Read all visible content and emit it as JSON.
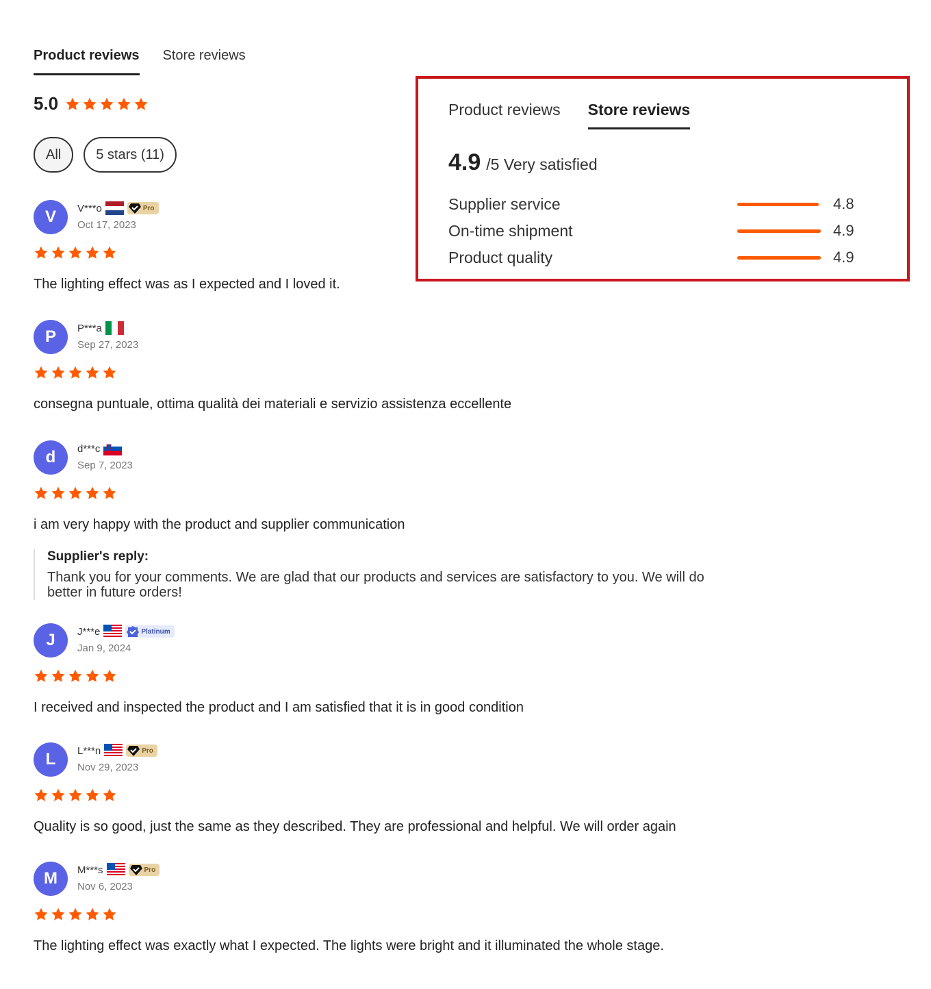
{
  "tabs": {
    "product": "Product reviews",
    "store": "Store reviews"
  },
  "summary": {
    "score": "5.0",
    "stars": 5
  },
  "filters": {
    "all": "All",
    "five": "5 stars (11)"
  },
  "reviews": [
    {
      "initial": "V",
      "name": "V***o",
      "flag": "netherlands",
      "badge": "Pro",
      "date": "Oct 17, 2023",
      "stars": 5,
      "text": "The lighting effect was as I expected and I loved it."
    },
    {
      "initial": "P",
      "name": "P***a",
      "flag": "italy",
      "badge": "",
      "date": "Sep 27, 2023",
      "stars": 5,
      "text": "consegna puntuale, ottima qualità dei materiali e servizio assistenza eccellente"
    },
    {
      "initial": "d",
      "name": "d***c",
      "flag": "slovenia",
      "badge": "",
      "date": "Sep 7, 2023",
      "stars": 5,
      "text": "i am very happy with the product and supplier communication",
      "reply_title": "Supplier's reply:",
      "reply_text": "Thank you for your comments. We are glad that our products and services are satisfactory to you. We will do better in future orders!"
    },
    {
      "initial": "J",
      "name": "J***e",
      "flag": "usa",
      "badge": "Platinum",
      "date": "Jan 9, 2024",
      "stars": 5,
      "text": "I received and inspected the product and I am satisfied that it is in good condition"
    },
    {
      "initial": "L",
      "name": "L***n",
      "flag": "usa",
      "badge": "Pro",
      "date": "Nov 29, 2023",
      "stars": 5,
      "text": "Quality is so good, just the same as they described. They are professional and helpful. We will order again"
    },
    {
      "initial": "M",
      "name": "M***s",
      "flag": "usa",
      "badge": "Pro",
      "date": "Nov 6, 2023",
      "stars": 5,
      "text": "The lighting effect was exactly what I expected. The lights were bright and it illuminated the whole stage."
    }
  ],
  "store_panel": {
    "tabs": {
      "product": "Product reviews",
      "store": "Store reviews"
    },
    "score": "4.9",
    "score_suffix": "/5 Very satisfied",
    "metrics": [
      {
        "label": "Supplier service",
        "value": "4.8",
        "fraction": 0.96
      },
      {
        "label": "On-time shipment",
        "value": "4.9",
        "fraction": 0.98
      },
      {
        "label": "Product quality",
        "value": "4.9",
        "fraction": 0.98
      }
    ]
  },
  "colors": {
    "accent": "#ff5a00",
    "avatar": "#5a63e6",
    "highlight_border": "#c8171e"
  }
}
